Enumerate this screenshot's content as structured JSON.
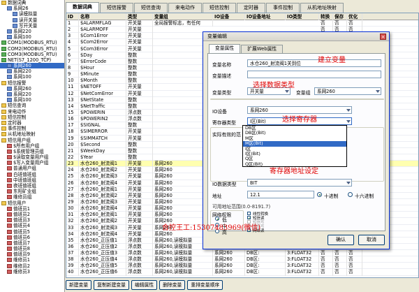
{
  "tree": [
    {
      "t": "数据词典",
      "i": "f",
      "d": 0
    },
    {
      "t": "系网26",
      "i": "n",
      "d": 1
    },
    {
      "t": "读模拟量",
      "i": "n",
      "d": 2
    },
    {
      "t": "读开关量",
      "i": "n",
      "d": 2
    },
    {
      "t": "写开关量",
      "i": "n",
      "d": 2
    },
    {
      "t": "系网220",
      "i": "n",
      "d": 1
    },
    {
      "t": "系网100",
      "i": "n",
      "d": 1
    },
    {
      "t": "COM1(MODBUS_RTU)",
      "i": "c",
      "d": 0
    },
    {
      "t": "COM2(MODBUS_RTU)",
      "i": "c",
      "d": 0
    },
    {
      "t": "COM3(MODBUS_RTU)",
      "i": "c",
      "d": 0
    },
    {
      "t": "NET(S7_1200_TCP)",
      "i": "c",
      "d": 0
    },
    {
      "t": "系网260",
      "i": "n",
      "d": 1,
      "sel": true
    },
    {
      "t": "系网220",
      "i": "n",
      "d": 1
    },
    {
      "t": "系网100",
      "i": "n",
      "d": 1
    },
    {
      "t": "短信报警",
      "i": "f",
      "d": 0
    },
    {
      "t": "系网260",
      "i": "n",
      "d": 1
    },
    {
      "t": "系网220",
      "i": "n",
      "d": 1
    },
    {
      "t": "系网100",
      "i": "n",
      "d": 1
    },
    {
      "t": "短信查询",
      "i": "f",
      "d": 0
    },
    {
      "t": "来电动作",
      "i": "f",
      "d": 0
    },
    {
      "t": "短信控制",
      "i": "f",
      "d": 0
    },
    {
      "t": "定时器",
      "i": "f",
      "d": 0
    },
    {
      "t": "事件控制",
      "i": "f",
      "d": 0
    },
    {
      "t": "从机地址映射",
      "i": "f",
      "d": 0
    },
    {
      "t": "短信用户组",
      "i": "f",
      "d": 0
    },
    {
      "t": "$所有用户组",
      "i": "r",
      "d": 1
    },
    {
      "t": "$系统管理员组",
      "i": "r",
      "d": 1
    },
    {
      "t": "$读取变量用户组",
      "i": "r",
      "d": 1
    },
    {
      "t": "$写入变量用户组",
      "i": "r",
      "d": 1
    },
    {
      "t": "普通用户组",
      "i": "r",
      "d": 1
    },
    {
      "t": "白班值班组",
      "i": "r",
      "d": 1
    },
    {
      "t": "中班值班组",
      "i": "r",
      "d": 1
    },
    {
      "t": "夜班值班组",
      "i": "r",
      "d": 1
    },
    {
      "t": "东阳矿业组",
      "i": "r",
      "d": 1
    },
    {
      "t": "维修员组",
      "i": "r",
      "d": 1
    },
    {
      "t": "短信用户",
      "i": "f",
      "d": 0
    },
    {
      "t": "值班员1",
      "i": "r",
      "d": 1
    },
    {
      "t": "值班员2",
      "i": "r",
      "d": 1
    },
    {
      "t": "值班员3",
      "i": "r",
      "d": 1
    },
    {
      "t": "值班员4",
      "i": "r",
      "d": 1
    },
    {
      "t": "值班员5",
      "i": "r",
      "d": 1
    },
    {
      "t": "值班员6",
      "i": "r",
      "d": 1
    },
    {
      "t": "值班员7",
      "i": "r",
      "d": 1
    },
    {
      "t": "值班员8",
      "i": "r",
      "d": 1
    },
    {
      "t": "值班员9",
      "i": "r",
      "d": 1
    },
    {
      "t": "维修员1",
      "i": "r",
      "d": 1
    },
    {
      "t": "维修员2",
      "i": "r",
      "d": 1
    },
    {
      "t": "维修员3",
      "i": "r",
      "d": 1
    }
  ],
  "tabs": [
    "数据词典",
    "短信报警",
    "短信查询",
    "来电动作",
    "短信控制",
    "定时器",
    "事件控制",
    "从机地址映射"
  ],
  "columns": [
    "ID",
    "名称",
    "类型",
    "变量组",
    "IO设备",
    "IO设备地址",
    "IO类型",
    "转换",
    "保存",
    "优化"
  ],
  "rows": [
    [
      "1",
      "$ALARMFLAG",
      "开关量",
      "全局报警标志，有任何",
      "",
      "",
      "",
      "否",
      "否",
      "否"
    ],
    [
      "2",
      "$ALARMOFF",
      "开关量",
      "",
      "",
      "",
      "",
      "否",
      "否",
      "否"
    ],
    [
      "3",
      "$Com1Error",
      "开关量",
      "",
      "",
      "",
      "",
      "否",
      "否",
      "否"
    ],
    [
      "4",
      "$Com2Error",
      "开关量",
      "",
      "",
      "",
      "",
      "否",
      "否",
      "否"
    ],
    [
      "5",
      "$Com3Error",
      "开关量",
      "",
      "",
      "",
      "",
      "否",
      "否",
      "否"
    ],
    [
      "6",
      "$Day",
      "整数",
      "",
      "",
      "",
      "",
      "否",
      "否",
      "否"
    ],
    [
      "7",
      "$ErrorCode",
      "整数",
      "",
      "",
      "",
      "",
      "否",
      "否",
      "否"
    ],
    [
      "8",
      "$Hour",
      "整数",
      "",
      "",
      "",
      "",
      "否",
      "否",
      "否"
    ],
    [
      "9",
      "$Minute",
      "整数",
      "",
      "",
      "",
      "",
      "否",
      "否",
      "否"
    ],
    [
      "10",
      "$Month",
      "整数",
      "",
      "",
      "",
      "",
      "否",
      "否",
      "否"
    ],
    [
      "11",
      "$NETOFF",
      "开关量",
      "",
      "",
      "",
      "",
      "否",
      "否",
      "否"
    ],
    [
      "12",
      "$NetComError",
      "开关量",
      "",
      "",
      "",
      "",
      "否",
      "否",
      "否"
    ],
    [
      "13",
      "$NetState",
      "整数",
      "",
      "",
      "",
      "",
      "否",
      "否",
      "否"
    ],
    [
      "14",
      "$NetTraffic",
      "整数",
      "",
      "",
      "",
      "",
      "否",
      "否",
      "否"
    ],
    [
      "15",
      "$POWERIN",
      "浮点数",
      "",
      "",
      "",
      "",
      "否",
      "否",
      "否"
    ],
    [
      "16",
      "$POWERIN2",
      "浮点数",
      "",
      "",
      "",
      "",
      "否",
      "否",
      "否"
    ],
    [
      "17",
      "$SIGNAL",
      "整数",
      "",
      "",
      "",
      "",
      "否",
      "否",
      "否"
    ],
    [
      "18",
      "$SIMERROR",
      "开关量",
      "",
      "",
      "",
      "",
      "否",
      "否",
      "否"
    ],
    [
      "19",
      "$SIMMATCH",
      "开关量",
      "",
      "",
      "",
      "",
      "否",
      "否",
      "否"
    ],
    [
      "20",
      "$Second",
      "整数",
      "",
      "",
      "",
      "",
      "否",
      "否",
      "否"
    ],
    [
      "21",
      "$WeekDay",
      "整数",
      "",
      "",
      "",
      "",
      "否",
      "否",
      "否"
    ],
    [
      "22",
      "$Year",
      "整数",
      "",
      "",
      "",
      "",
      "否",
      "否",
      "否"
    ],
    [
      "23",
      "水仓260_射流阀1",
      "开关量",
      "系网260",
      "",
      "",
      "",
      "否",
      "否",
      "否"
    ],
    [
      "24",
      "水仓260_射流阀2",
      "开关量",
      "系网260",
      "",
      "",
      "",
      "否",
      "否",
      "否"
    ],
    [
      "25",
      "水仓260_射流阀3",
      "开关量",
      "系网260",
      "",
      "",
      "",
      "否",
      "否",
      "否"
    ],
    [
      "26",
      "水仓260_射流阀4",
      "开关量",
      "系网260",
      "",
      "",
      "",
      "否",
      "否",
      "否"
    ],
    [
      "27",
      "水仓260_射流阀1",
      "开关量",
      "系网260",
      "",
      "",
      "",
      "否",
      "否",
      "否"
    ],
    [
      "28",
      "水仓260_射流阀2",
      "开关量",
      "系网260",
      "",
      "",
      "",
      "否",
      "否",
      "否"
    ],
    [
      "29",
      "水仓260_射流阀3",
      "开关量",
      "系网260",
      "",
      "",
      "",
      "否",
      "否",
      "否"
    ],
    [
      "30",
      "水仓260_射流阀4",
      "开关量",
      "系网260",
      "",
      "",
      "",
      "否",
      "否",
      "否"
    ],
    [
      "31",
      "水仓260_射流阀1",
      "开关量",
      "系网260",
      "",
      "",
      "",
      "否",
      "否",
      "否"
    ],
    [
      "32",
      "水仓260_射流阀2",
      "开关量",
      "系网260",
      "",
      "",
      "",
      "否",
      "否",
      "否"
    ],
    [
      "33",
      "水仓260_射流阀3",
      "开关量",
      "系网260",
      "",
      "",
      "",
      "否",
      "否",
      "否"
    ],
    [
      "34",
      "水仓260_射流阀4",
      "开关量",
      "系网260",
      "",
      "",
      "",
      "否",
      "否",
      "否"
    ],
    [
      "35",
      "水仓260_正压值1",
      "浮点数",
      "系网260,读模拟量",
      "系网260",
      "DB区:",
      "3:FLOAT32",
      "否",
      "否",
      "否"
    ],
    [
      "36",
      "水仓260_正压值2",
      "浮点数",
      "系网260,读模拟量",
      "系网260",
      "DB区:",
      "3:FLOAT32",
      "否",
      "否",
      "否"
    ],
    [
      "37",
      "水仓260_正压值3",
      "浮点数",
      "系网260,读模拟量",
      "系网260",
      "DB区:",
      "3:FLOAT32",
      "否",
      "否",
      "否"
    ],
    [
      "38",
      "水仓260_正压值4",
      "浮点数",
      "系网260,读模拟量",
      "系网260",
      "DB区:",
      "3:FLOAT32",
      "否",
      "否",
      "否"
    ],
    [
      "39",
      "水仓260_正压值5",
      "浮点数",
      "系网260,读模拟量",
      "系网260",
      "DB区:",
      "3:FLOAT32",
      "否",
      "否",
      "否"
    ],
    [
      "40",
      "水仓260_正压值6",
      "浮点数",
      "系网260,读模拟量",
      "系网260",
      "DB区:",
      "3:FLOAT32",
      "否",
      "否",
      "否"
    ]
  ],
  "buttons": [
    "新建变量",
    "复制新建变量",
    "编辑属性",
    "删除变量",
    "重排变量顺序"
  ],
  "dialog": {
    "title": "变量编辑",
    "tabs": [
      "变量属性",
      "扩展Web属性"
    ],
    "name_label": "变量名称",
    "name_value": "水仓260_射流阀1关到位",
    "desc_label": "变量描述",
    "type_label": "变量类型",
    "type_value": "开关量",
    "group_label": "变量组",
    "group_value": "系网260",
    "io_label": "IO设备",
    "io_value": "系网260",
    "reg_label": "寄存器类型",
    "reg_value": "I区(Bit)",
    "note_label": "实际有效的范",
    "reg_options": [
      "DB区",
      "DB区(Bit)",
      "M区",
      "M区(Bit)",
      "I区",
      "I区(Bit)",
      "Q区",
      "Q区(Bit)"
    ],
    "data_type_label": "IO数据类型",
    "data_type_value": "BIT",
    "addr_label": "地址",
    "addr_value": "12.1",
    "dec_label": "十进制",
    "hex_label": "十六进制",
    "range_label": "可用地址范围(0.0-8191.7)",
    "net_label": "网络权限",
    "net_options": [
      "低",
      "中",
      "高"
    ],
    "checks": [
      {
        "t": "线性转换",
        "on": false,
        "dis": false
      },
      {
        "t": "短信读",
        "on": true,
        "dis": false
      },
      {
        "t": "短信写",
        "on": false,
        "dis": true
      },
      {
        "t": "网络写",
        "on": false,
        "dis": true
      },
      {
        "t": "网络读",
        "on": true,
        "dis": false
      }
    ],
    "ok": "确认",
    "cancel": "取消"
  },
  "annotations": {
    "a1": "建立变量",
    "a2": "选择数据类型",
    "a3": "选择寄存器",
    "a4": "寄存器地址设定",
    "a5": "合控王工:15307483969(微信)"
  },
  "colors": {
    "accent": "#316ac5",
    "highlight": "#ffffb0",
    "annotation": "#e00000"
  }
}
